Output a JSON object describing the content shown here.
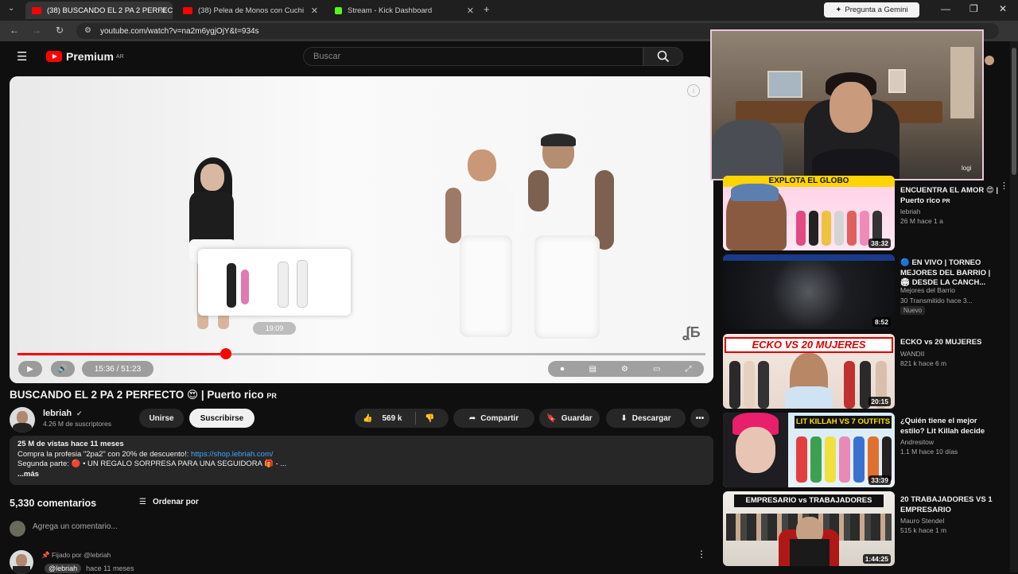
{
  "browser": {
    "tabs": [
      {
        "label": "(38) BUSCANDO EL 2 PA 2 PERFEC",
        "fav": "#ff0000"
      },
      {
        "label": "(38) Pelea de Monos con Cuchi",
        "fav": "#ff0000"
      },
      {
        "label": "Stream - Kick Dashboard",
        "fav": "#53fc18"
      }
    ],
    "gemini": "Pregunta a Gemini",
    "url": "youtube.com/watch?v=na2m6ygjOjY&t=934s"
  },
  "youtube": {
    "logo": "Premium",
    "region": "AR",
    "search_placeholder": "Buscar"
  },
  "player": {
    "current_time": "15:36 / 51:23",
    "hover_time": "19:09",
    "progress": 0.303
  },
  "video": {
    "title": "BUSCANDO EL 2 PA 2 PERFECTO 😍 | Puerto rico",
    "title_badge": "PR",
    "channel": "lebriah",
    "subscribers": "4.26 M de suscriptores",
    "join_label": "Unirse",
    "subscribe_label": "Suscribirse",
    "likes": "569 k",
    "share_label": "Compartir",
    "save_label": "Guardar",
    "download_label": "Descargar"
  },
  "description": {
    "stats": "25 M de vistas  hace 11 meses",
    "line1_text": "Compra la profesia \"2pa2\" con 20% de descuento!: ",
    "line1_link": "https://shop.lebriah.com/",
    "line2": "Segunda parte: 🔴 • UN REGALO SORPRESA PARA UNA SEGUIDORA 🎁 - ...",
    "more": "...más"
  },
  "comments": {
    "count": "5,330 comentarios",
    "sort_label": "Ordenar por",
    "add_placeholder": "Agrega un comentario...",
    "pinned_label": "Fijado por @lebriah",
    "author": "@lebriah",
    "time": "hace 11 meses"
  },
  "webcam": {
    "label": "logi"
  },
  "sidebar": [
    {
      "title": "ENCUENTRA EL AMOR 😍 | Puerto rico",
      "badge": "PR",
      "channel": "lebriah",
      "meta": "26 M  hace 1 a",
      "duration": "38:32",
      "thumb_text": "EXPLOTA EL GLOBO"
    },
    {
      "title": "🔵 EN VIVO | TORNEO MEJORES DEL BARRIO | 🏟 DESDE LA CANCH...",
      "channel": "Mejores del Barrio",
      "meta": "30  Transmitido hace 3...",
      "duration": "8:52",
      "new_label": "Nuevo"
    },
    {
      "title": "ECKO vs 20 MUJERES",
      "channel": "WANDII",
      "meta": "821 k  hace 6 m",
      "duration": "20:15",
      "thumb_text": "ECKO VS 20 MUJERES"
    },
    {
      "title": "¿Quién tiene el mejor estilo? Lit Killah decide",
      "channel": "Andresitow",
      "meta": "1.1 M  hace 10 días",
      "duration": "33:39",
      "thumb_text": "LIT KILLAH VS 7 OUTFITS"
    },
    {
      "title": "20 TRABAJADORES VS 1 EMPRESARIO",
      "channel": "Mauro Stendel",
      "meta": "515 k  hace 1 m",
      "duration": "1:44:25",
      "thumb_text": "EMPRESARIO vs TRABAJADORES"
    }
  ]
}
